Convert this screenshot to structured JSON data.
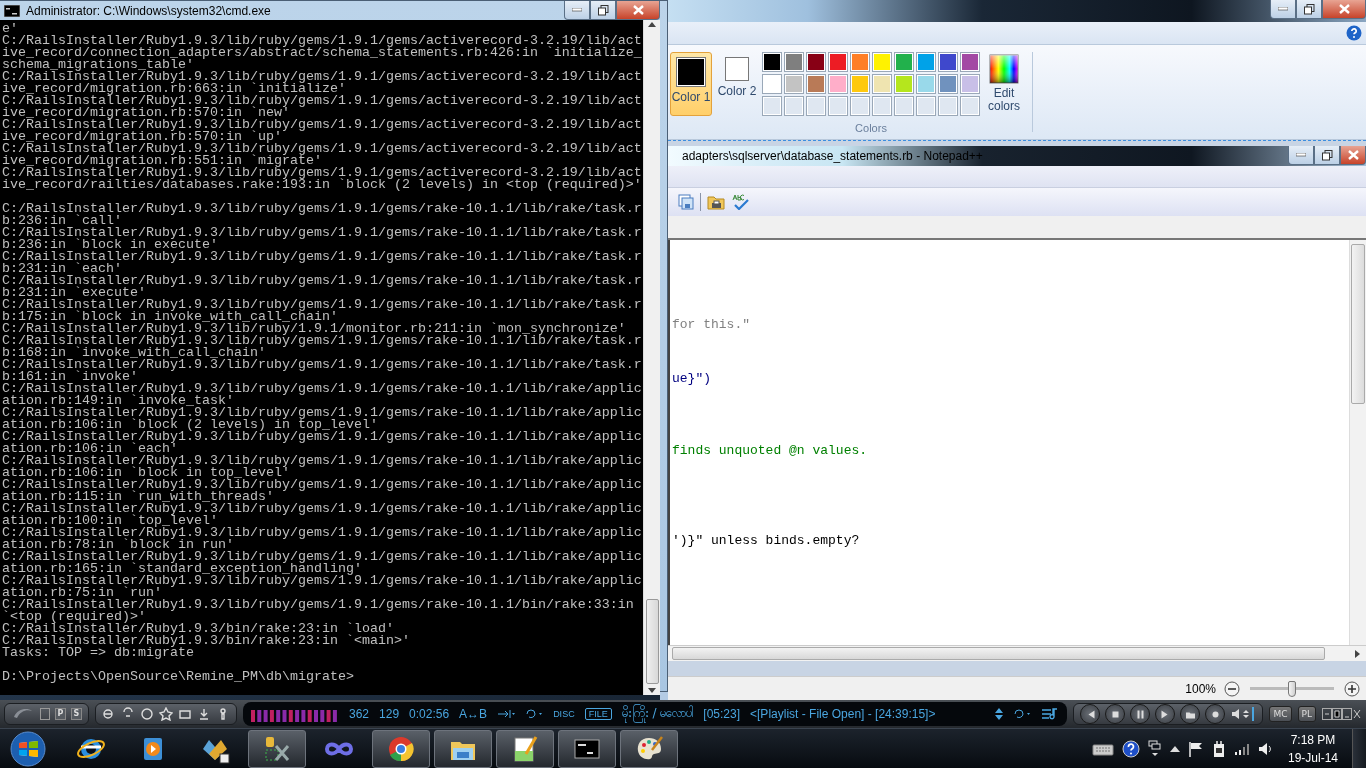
{
  "console_window": {
    "title": "Administrator: C:\\Windows\\system32\\cmd.exe",
    "output_blocks": [
      [
        "e'",
        "C:/RailsInstaller/Ruby1.9.3/lib/ruby/gems/1.9.1/gems/activerecord-3.2.19/lib/act",
        "ive_record/connection_adapters/abstract/schema_statements.rb:426:in `initialize_",
        "schema_migrations_table'",
        "C:/RailsInstaller/Ruby1.9.3/lib/ruby/gems/1.9.1/gems/activerecord-3.2.19/lib/act",
        "ive_record/migration.rb:663:in `initialize'",
        "C:/RailsInstaller/Ruby1.9.3/lib/ruby/gems/1.9.1/gems/activerecord-3.2.19/lib/act",
        "ive_record/migration.rb:570:in `new'",
        "C:/RailsInstaller/Ruby1.9.3/lib/ruby/gems/1.9.1/gems/activerecord-3.2.19/lib/act",
        "ive_record/migration.rb:570:in `up'",
        "C:/RailsInstaller/Ruby1.9.3/lib/ruby/gems/1.9.1/gems/activerecord-3.2.19/lib/act",
        "ive_record/migration.rb:551:in `migrate'",
        "C:/RailsInstaller/Ruby1.9.3/lib/ruby/gems/1.9.1/gems/activerecord-3.2.19/lib/act",
        "ive_record/railties/databases.rake:193:in `block (2 levels) in <top (required)>'"
      ],
      [
        "C:/RailsInstaller/Ruby1.9.3/lib/ruby/gems/1.9.1/gems/rake-10.1.1/lib/rake/task.r",
        "b:236:in `call'",
        "C:/RailsInstaller/Ruby1.9.3/lib/ruby/gems/1.9.1/gems/rake-10.1.1/lib/rake/task.r",
        "b:236:in `block in execute'",
        "C:/RailsInstaller/Ruby1.9.3/lib/ruby/gems/1.9.1/gems/rake-10.1.1/lib/rake/task.r",
        "b:231:in `each'",
        "C:/RailsInstaller/Ruby1.9.3/lib/ruby/gems/1.9.1/gems/rake-10.1.1/lib/rake/task.r",
        "b:231:in `execute'",
        "C:/RailsInstaller/Ruby1.9.3/lib/ruby/gems/1.9.1/gems/rake-10.1.1/lib/rake/task.r",
        "b:175:in `block in invoke_with_call_chain'",
        "C:/RailsInstaller/Ruby1.9.3/lib/ruby/1.9.1/monitor.rb:211:in `mon_synchronize'",
        "C:/RailsInstaller/Ruby1.9.3/lib/ruby/gems/1.9.1/gems/rake-10.1.1/lib/rake/task.r",
        "b:168:in `invoke_with_call_chain'",
        "C:/RailsInstaller/Ruby1.9.3/lib/ruby/gems/1.9.1/gems/rake-10.1.1/lib/rake/task.r",
        "b:161:in `invoke'",
        "C:/RailsInstaller/Ruby1.9.3/lib/ruby/gems/1.9.1/gems/rake-10.1.1/lib/rake/applic",
        "ation.rb:149:in `invoke_task'",
        "C:/RailsInstaller/Ruby1.9.3/lib/ruby/gems/1.9.1/gems/rake-10.1.1/lib/rake/applic",
        "ation.rb:106:in `block (2 levels) in top_level'",
        "C:/RailsInstaller/Ruby1.9.3/lib/ruby/gems/1.9.1/gems/rake-10.1.1/lib/rake/applic",
        "ation.rb:106:in `each'",
        "C:/RailsInstaller/Ruby1.9.3/lib/ruby/gems/1.9.1/gems/rake-10.1.1/lib/rake/applic",
        "ation.rb:106:in `block in top_level'",
        "C:/RailsInstaller/Ruby1.9.3/lib/ruby/gems/1.9.1/gems/rake-10.1.1/lib/rake/applic",
        "ation.rb:115:in `run_with_threads'",
        "C:/RailsInstaller/Ruby1.9.3/lib/ruby/gems/1.9.1/gems/rake-10.1.1/lib/rake/applic",
        "ation.rb:100:in `top_level'",
        "C:/RailsInstaller/Ruby1.9.3/lib/ruby/gems/1.9.1/gems/rake-10.1.1/lib/rake/applic",
        "ation.rb:78:in `block in run'",
        "C:/RailsInstaller/Ruby1.9.3/lib/ruby/gems/1.9.1/gems/rake-10.1.1/lib/rake/applic",
        "ation.rb:165:in `standard_exception_handling'",
        "C:/RailsInstaller/Ruby1.9.3/lib/ruby/gems/1.9.1/gems/rake-10.1.1/lib/rake/applic",
        "ation.rb:75:in `run'",
        "C:/RailsInstaller/Ruby1.9.3/lib/ruby/gems/1.9.1/gems/rake-10.1.1/bin/rake:33:in",
        "`<top (required)>'",
        "C:/RailsInstaller/Ruby1.9.3/bin/rake:23:in `load'",
        "C:/RailsInstaller/Ruby1.9.3/bin/rake:23:in `<main>'",
        "Tasks: TOP => db:migrate"
      ],
      [
        "D:\\Projects\\OpenSource\\Remine_PM\\db\\migrate>"
      ]
    ]
  },
  "paint_window": {
    "color_buttons": [
      {
        "label": "Color 1",
        "color": "#000000",
        "selected": true
      },
      {
        "label": "Color 2",
        "color": "#ffffff",
        "selected": false
      }
    ],
    "palette": [
      {
        "color": "#000000"
      },
      {
        "color": "#7f7f7f"
      },
      {
        "color": "#880015"
      },
      {
        "color": "#ed1c24"
      },
      {
        "color": "#ff7f27"
      },
      {
        "color": "#fff200"
      },
      {
        "color": "#22b14c"
      },
      {
        "color": "#00a2e8"
      },
      {
        "color": "#3f48cc"
      },
      {
        "color": "#a349a4"
      },
      {
        "color": "#ffffff"
      },
      {
        "color": "#c3c3c3"
      },
      {
        "color": "#b97a57"
      },
      {
        "color": "#ffaec9"
      },
      {
        "color": "#ffc90e"
      },
      {
        "color": "#efe4b0"
      },
      {
        "color": "#b5e61d"
      },
      {
        "color": "#99d9ea"
      },
      {
        "color": "#7092be"
      },
      {
        "color": "#c8bfe7"
      }
    ],
    "edit_colors_label": "Edit colors",
    "group_label": "Colors",
    "zoom": {
      "reading": "100%",
      "level": 0.5
    }
  },
  "editor_window": {
    "title": "adapters\\sqlserver\\database_statements.rb - Notepad++",
    "code_lines": [
      {
        "text": "for this.\"",
        "kind": "string"
      },
      {
        "text": "ue}\")",
        "kind": "code"
      },
      {
        "text": "finds unquoted @n values.",
        "kind": "comment"
      },
      {
        "text": "')}\" unless binds.empty?",
        "kind": "plain"
      }
    ]
  },
  "media_player": {
    "mode_buttons": [
      "P",
      "S"
    ],
    "counter_1": "362",
    "counter_2": "129",
    "elapsed": "0:02:56",
    "ab_label": "A↔B",
    "disc_label": "DISC",
    "file_label": "FILE",
    "track_title": "မိုးကြိုး / မလောပါ",
    "track_length": "[05:23]",
    "playlist_info": "<[Playlist - File Open] - [24:39:15]>",
    "view_buttons": [
      "MC",
      "PL"
    ]
  },
  "taskbar": {
    "apps": [
      {
        "kind": "ie",
        "running": false
      },
      {
        "kind": "media",
        "running": false
      },
      {
        "kind": "studio",
        "running": false
      },
      {
        "kind": "tools",
        "running": true
      },
      {
        "kind": "infinity",
        "running": false
      },
      {
        "kind": "chrome",
        "running": true
      },
      {
        "kind": "folder",
        "running": true
      },
      {
        "kind": "notepad",
        "running": true
      },
      {
        "kind": "console",
        "running": true
      },
      {
        "kind": "paint",
        "running": true
      }
    ],
    "time": "7:18 PM",
    "date": "19-Jul-14"
  }
}
